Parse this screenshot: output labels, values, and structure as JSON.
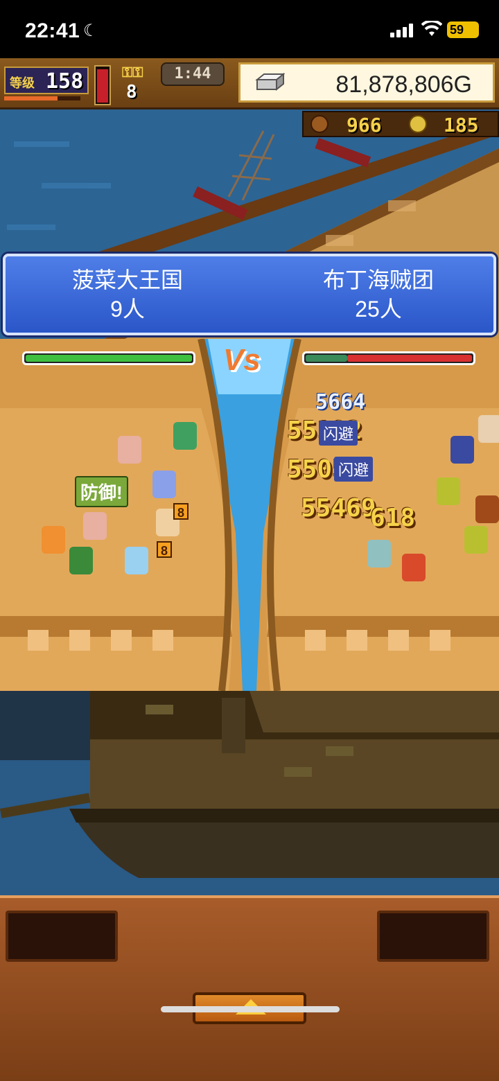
{
  "status_bar": {
    "time": "22:41",
    "battery": "59"
  },
  "hud": {
    "level_label": "等级",
    "level": "158",
    "keys": "8",
    "timer": "1:44",
    "gold": "81,878,806G",
    "resource_1": "966",
    "resource_2": "185"
  },
  "battle": {
    "left_team": {
      "name": "菠菜大王国",
      "count": "9人"
    },
    "right_team": {
      "name": "布丁海贼团",
      "count": "25人"
    },
    "vs_label": "Vs",
    "left_hp_fraction": 1.0,
    "right_hp_fraction": 0.75,
    "defend_label": "防御!",
    "dodge_label": "闪避",
    "damage_numbers": [
      "5664",
      "55192",
      "55056",
      "55469",
      "618"
    ],
    "unit_badge": "8"
  },
  "colors": {
    "hp_green": "#3fbf3f",
    "hp_red": "#d83030",
    "header_blue": "#3a66d8",
    "gold_text": "#f6d24a"
  },
  "icons": [
    "moon-icon",
    "signal-icon",
    "wifi-icon",
    "battery-icon",
    "silver-bar-icon",
    "key-icon",
    "food-icon",
    "coin-icon",
    "up-arrow-icon"
  ]
}
